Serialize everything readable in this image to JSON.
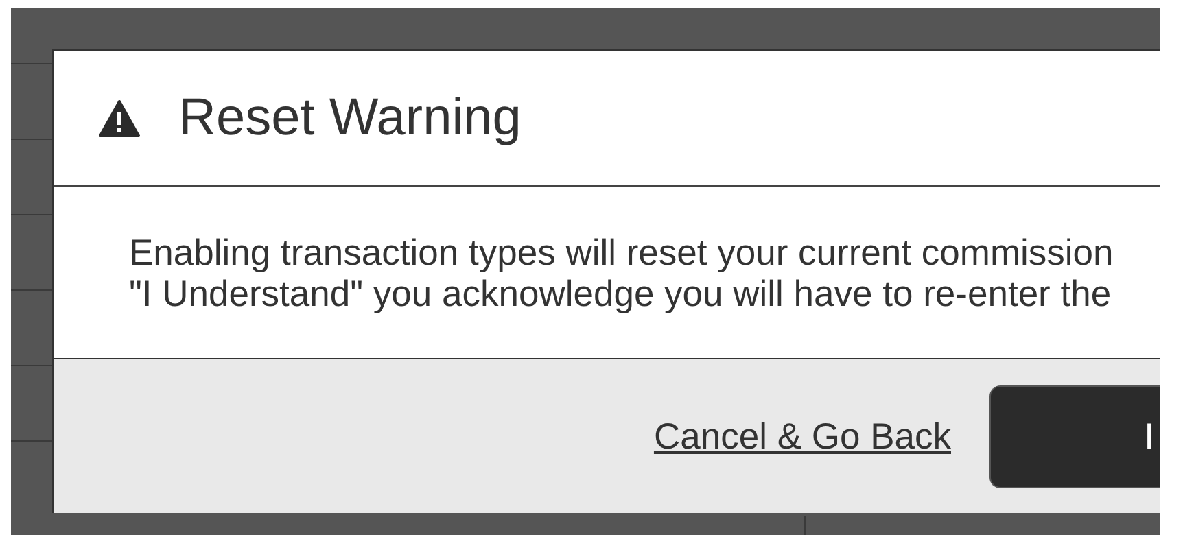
{
  "dialog": {
    "title": "Reset Warning",
    "message_lines": [
      "Enabling transaction types will reset your current commission",
      "\"I Understand\" you acknowledge you will have to re-enter the"
    ],
    "buttons": [
      {
        "label": "Cancel & Go Back",
        "kind": "link"
      },
      {
        "label": "I",
        "kind": "primary"
      }
    ]
  }
}
